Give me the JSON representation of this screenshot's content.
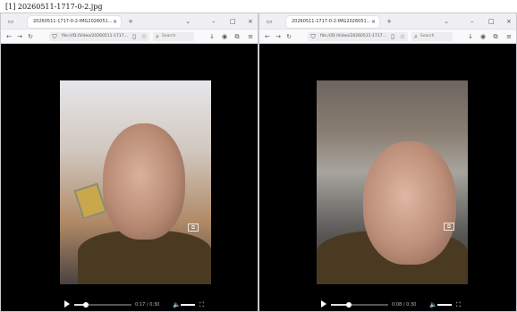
{
  "caption": "[1] 20260511-1717-0-2.jpg",
  "windows": [
    {
      "tab_title": "20260511-1717-0-2-IMG2026051...",
      "url": "file:///D:/Video/20260511-1717...",
      "search_placeholder": "Search",
      "video": {
        "time_display": "0:17 / 0:30",
        "progress": 0.2
      }
    },
    {
      "tab_title": "20260511-1717-0-2-IMG2026051...",
      "url": "file:///D:/Video/20260511-1717...",
      "search_placeholder": "Search",
      "video": {
        "time_display": "0:08 / 0:30",
        "progress": 0.32
      }
    }
  ],
  "icons": {
    "tab_overview": "▭",
    "new_tab": "+",
    "tab_list": "⌄",
    "minimize": "–",
    "restore": "□",
    "close": "×",
    "back": "←",
    "forward": "→",
    "reload": "↻",
    "shield": "⛉",
    "page": "▯",
    "bookmark": "☆",
    "search": "⌕",
    "download": "↓",
    "account": "◉",
    "extensions": "⧉",
    "menu": "≡",
    "play": "▶",
    "volume": "🔈",
    "fullscreen": "⛶",
    "pip": "⧉"
  }
}
